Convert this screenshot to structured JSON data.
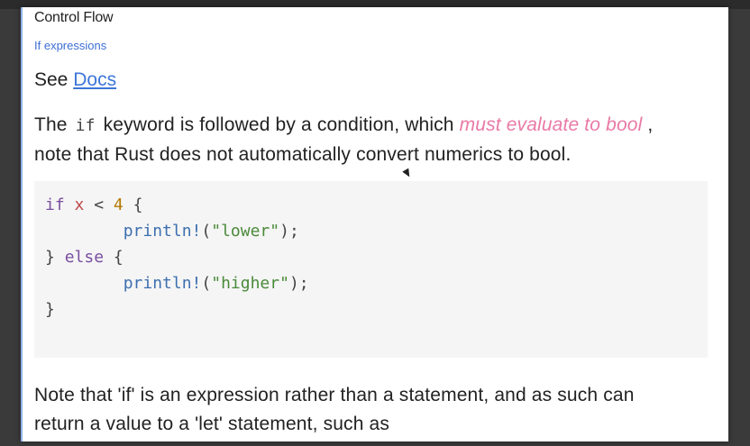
{
  "doc": {
    "title": "Control Flow",
    "subnav": "If expressions",
    "see_prefix": "See",
    "see_link": "Docs",
    "para1": {
      "part1": "The",
      "code": "if",
      "part2": "keyword is followed by a condition, which",
      "emphasis": "must evaluate to bool",
      "part3": ",",
      "line2": "note that Rust does not automatically convert numerics to bool."
    },
    "code_lines": [
      "if x < 4 {",
      "        println!(\"lower\");",
      "} else {",
      "        println!(\"higher\");",
      "}"
    ],
    "para2": {
      "line1": "Note that 'if' is an expression rather than a statement, and as such can",
      "line2": "return a value to a 'let' statement, such as"
    }
  }
}
